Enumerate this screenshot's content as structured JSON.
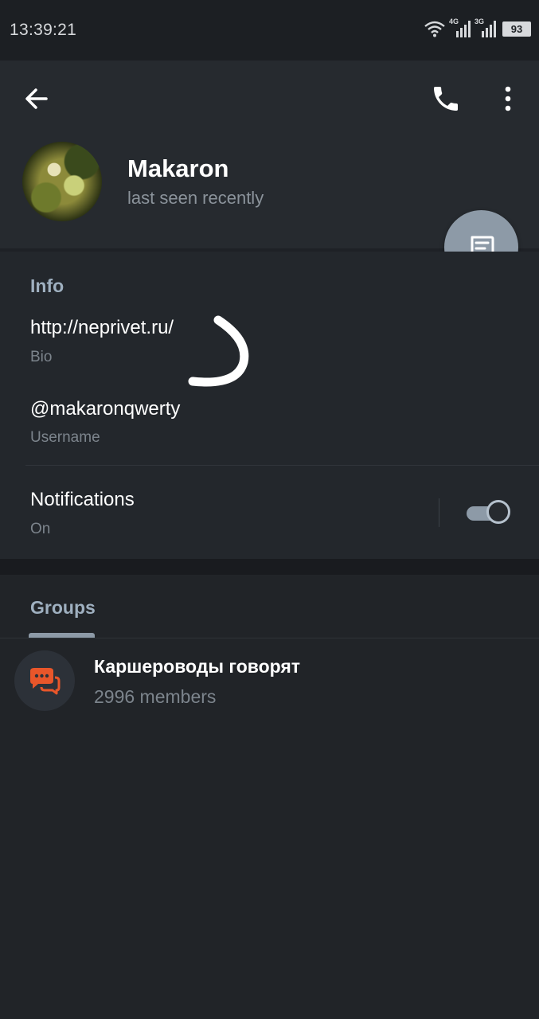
{
  "status_bar": {
    "time": "13:39:21",
    "network_4g": "4G",
    "network_3g": "3G",
    "battery": "93"
  },
  "header": {
    "back_icon": "arrow-left-icon",
    "call_icon": "phone-icon",
    "menu_icon": "more-vert-icon"
  },
  "profile": {
    "name": "Makaron",
    "status": "last seen recently"
  },
  "fab": {
    "icon": "message-icon"
  },
  "info": {
    "title": "Info",
    "bio_value": "http://neprivet.ru/",
    "bio_label": "Bio",
    "username_value": "@makaronqwerty",
    "username_label": "Username",
    "notifications_label": "Notifications",
    "notifications_value": "On",
    "notifications_enabled": true
  },
  "groups": {
    "tab_label": "Groups",
    "items": [
      {
        "name": "Каршероводы говорят",
        "members": "2996 members"
      }
    ]
  },
  "colors": {
    "background": "#1e2126",
    "header": "#262a2f",
    "accent": "#8d9aa7",
    "section_title": "#9fb0c0",
    "secondary_text": "#7c848c"
  }
}
